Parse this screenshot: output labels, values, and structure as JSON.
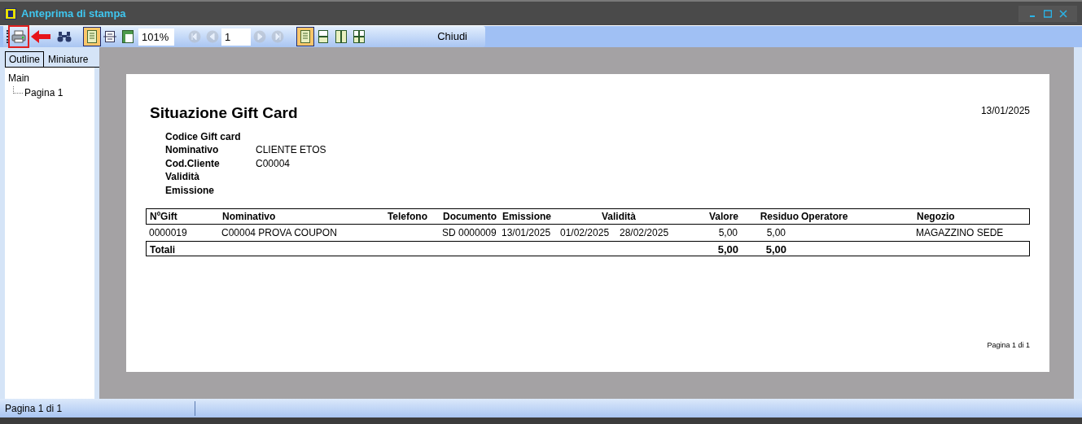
{
  "window": {
    "title": "Anteprima di stampa"
  },
  "toolbar": [
    {
      "kind": "print",
      "selected": false,
      "highlighted": true
    },
    {
      "kind": "find",
      "selected": false
    },
    {
      "kind": "sep"
    },
    {
      "kind": "single-page",
      "selected": true
    },
    {
      "kind": "fit-width",
      "selected": false
    },
    {
      "kind": "whole-page",
      "selected": false
    },
    {
      "kind": "zoom",
      "value": "101%"
    },
    {
      "kind": "sep"
    },
    {
      "kind": "first",
      "disabled": true
    },
    {
      "kind": "prev",
      "disabled": true
    },
    {
      "kind": "page",
      "value": "1"
    },
    {
      "kind": "next",
      "disabled": true
    },
    {
      "kind": "last",
      "disabled": true
    },
    {
      "kind": "sep"
    },
    {
      "kind": "view-1",
      "selected": true
    },
    {
      "kind": "view-2",
      "selected": false
    },
    {
      "kind": "view-3",
      "selected": false
    },
    {
      "kind": "view-4",
      "selected": false
    },
    {
      "kind": "close",
      "label": "Chiudi"
    }
  ],
  "side_tabs": [
    {
      "label": "Outline",
      "selected": true
    },
    {
      "label": "Miniature",
      "selected": false
    }
  ],
  "outline": [
    {
      "label": "Main",
      "children": [
        {
          "label": "Pagina 1"
        }
      ]
    }
  ],
  "report": {
    "title": "Situazione Gift Card",
    "date": "13/01/2025",
    "fields": [
      {
        "label": "Codice Gift card"
      },
      {
        "label": "Nominativo",
        "value": "CLIENTE ETOS"
      },
      {
        "label": "Cod.Cliente",
        "value": "C00004"
      },
      {
        "label": "Validità"
      },
      {
        "label": "Emissione"
      }
    ],
    "columns": [
      "NºGift",
      "Nominativo",
      "Telefono",
      "Documento",
      "Emissione",
      "Validità",
      "Valore",
      "Residuo",
      "Operatore",
      "Negozio"
    ],
    "rows": [
      {
        "nr_gift": "0000019",
        "nominativo": "C00004 PROVA COUPON",
        "documento": "SD 0000009",
        "emissione": "13/01/2025",
        "validita_dal": "01/02/2025",
        "validita_al": "28/02/2025",
        "valore": "5,00",
        "residuo": "5,00",
        "negozio": "MAGAZZINO SEDE"
      }
    ],
    "totals": {
      "label": "Totali",
      "valore": "5,00",
      "residuo": "5,00"
    },
    "footer": "Pagina 1 di 1"
  },
  "status_bar": {
    "text": "Pagina 1 di 1"
  }
}
